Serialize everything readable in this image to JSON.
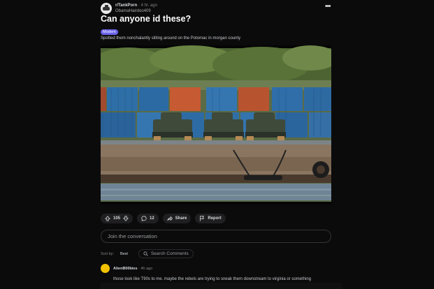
{
  "post": {
    "subreddit": "r/TankPorn",
    "time_sep": " · ",
    "time": "4 hr. ago",
    "author": "ObamaHairdoo409",
    "title": "Can anyone id these?",
    "flair": "Modern",
    "body": "Spotted them nonchalantly sitting around on the Potomac in morgan county"
  },
  "actions": {
    "vote_count": "105",
    "comment_count": "12",
    "share_label": "Share",
    "report_label": "Report"
  },
  "join": {
    "placeholder": "Join the conversation"
  },
  "sort": {
    "label": "Sort by:",
    "value": "Best",
    "search_placeholder": "Search Comments"
  },
  "comment": {
    "author": "AlienB00bies",
    "time_sep": " · ",
    "time": "4h ago",
    "text": "those look like T90s to me. maybe the rebels are trying to sneak them downstream to virginia or something"
  },
  "icons": {
    "more": "more-horizontal-icon",
    "upvote": "arrow-up-icon",
    "downvote": "arrow-down-icon",
    "comment": "speech-bubble-icon",
    "share": "share-arrow-icon",
    "report": "flag-icon",
    "search": "search-icon"
  },
  "colors": {
    "background": "#0b0b0c",
    "flair": "#6b63e8",
    "pill": "#1f1f21",
    "comment_avatar": "#f2c200"
  }
}
